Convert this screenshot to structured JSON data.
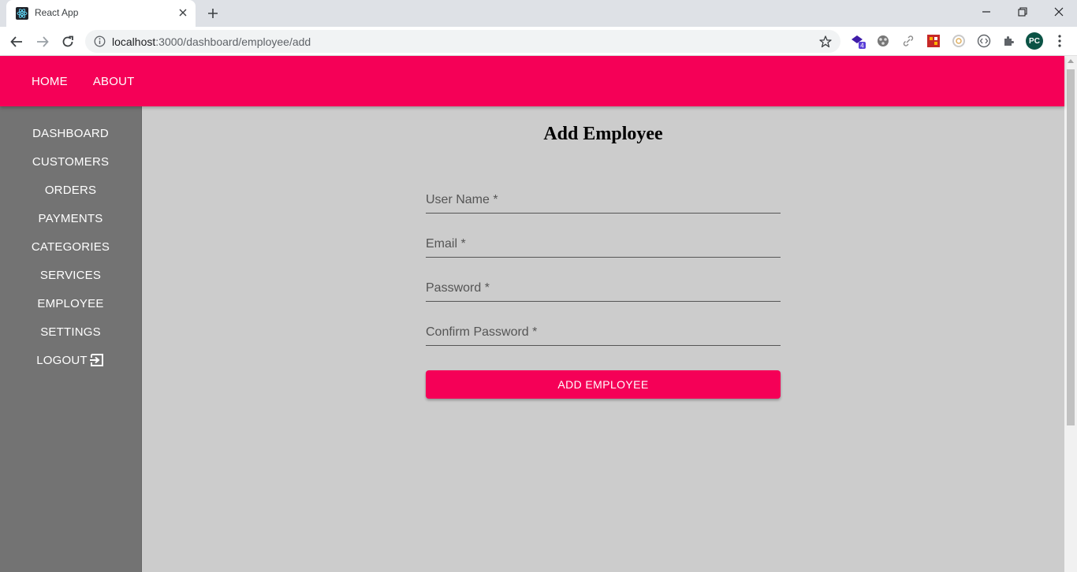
{
  "browser": {
    "tab_title": "React App",
    "url_host": "localhost",
    "url_rest": ":3000/dashboard/employee/add",
    "profile_initials": "PC",
    "extension_badge": "4"
  },
  "appbar": {
    "links": [
      {
        "label": "HOME"
      },
      {
        "label": "ABOUT"
      }
    ],
    "color": "#f50057"
  },
  "sidebar": {
    "items": [
      {
        "label": "DASHBOARD"
      },
      {
        "label": "CUSTOMERS"
      },
      {
        "label": "ORDERS"
      },
      {
        "label": "PAYMENTS"
      },
      {
        "label": "CATEGORIES"
      },
      {
        "label": "SERVICES"
      },
      {
        "label": "EMPLOYEE"
      },
      {
        "label": "SETTINGS"
      },
      {
        "label": "LOGOUT"
      }
    ],
    "color": "#737373"
  },
  "form": {
    "title": "Add Employee",
    "fields": [
      {
        "label": "User Name *",
        "value": ""
      },
      {
        "label": "Email *",
        "value": ""
      },
      {
        "label": "Password *",
        "value": ""
      },
      {
        "label": "Confirm Password *",
        "value": ""
      }
    ],
    "submit_label": "ADD EMPLOYEE"
  }
}
